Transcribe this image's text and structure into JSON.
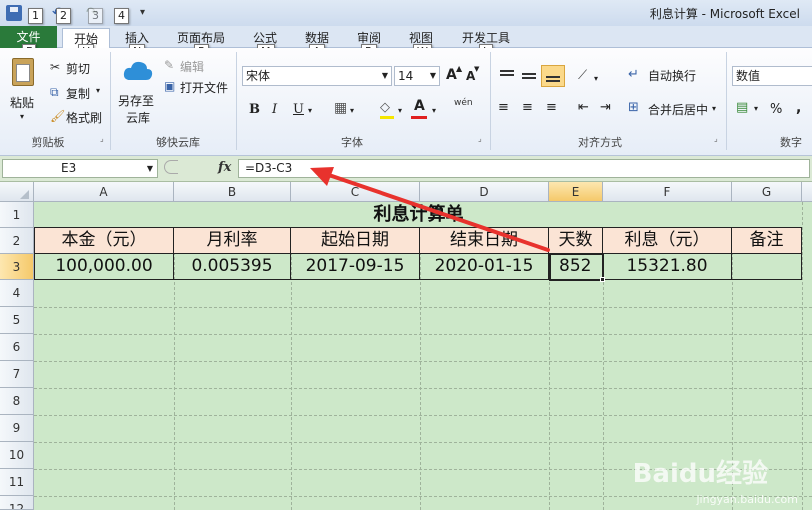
{
  "window": {
    "title": "利息计算 - Microsoft Excel"
  },
  "quick_access": {
    "keytips": [
      "1",
      "2",
      "3",
      "4"
    ]
  },
  "tabs": {
    "file": "文件",
    "items": [
      {
        "label": "开始",
        "key": "H"
      },
      {
        "label": "插入",
        "key": "N"
      },
      {
        "label": "页面布局",
        "key": "P"
      },
      {
        "label": "公式",
        "key": "M"
      },
      {
        "label": "数据",
        "key": "A"
      },
      {
        "label": "审阅",
        "key": "R"
      },
      {
        "label": "视图",
        "key": "W"
      },
      {
        "label": "开发工具",
        "key": "L"
      }
    ],
    "file_key": "F"
  },
  "ribbon": {
    "clipboard": {
      "paste": "粘贴",
      "cut": "剪切",
      "copy": "复制",
      "format_painter": "格式刷",
      "label": "剪贴板"
    },
    "cloud": {
      "save_to": "另存至",
      "cloud": "云库",
      "edit": "编辑",
      "open_file": "打开文件",
      "label": "够快云库"
    },
    "font": {
      "name": "宋体",
      "size": "14",
      "bold": "B",
      "italic": "I",
      "underline": "U",
      "grow": "A",
      "shrink": "A",
      "font_color": "A",
      "phonetic": "wén",
      "label": "字体"
    },
    "alignment": {
      "wrap": "自动换行",
      "merge": "合并后居中",
      "label": "对齐方式"
    },
    "number": {
      "format": "数值",
      "percent": "%",
      "comma": ",",
      "label": "数字"
    }
  },
  "formula_bar": {
    "name_box": "E3",
    "fx": "fx",
    "formula": "=D3-C3"
  },
  "sheet": {
    "columns": [
      "A",
      "B",
      "C",
      "D",
      "E",
      "F",
      "G"
    ],
    "rows": [
      "1",
      "2",
      "3",
      "4",
      "5",
      "6",
      "7",
      "8",
      "9",
      "10",
      "11",
      "12"
    ],
    "title": "利息计算单",
    "headers": [
      "本金（元）",
      "月利率",
      "起始日期",
      "结束日期",
      "天数",
      "利息（元）",
      "备注"
    ],
    "data": [
      "100,000.00",
      "0.005395",
      "2017-09-15",
      "2020-01-15",
      "852",
      "15321.80",
      ""
    ],
    "header_fill": "#fbe4d5",
    "sheet_fill": "#cde8c9"
  },
  "annotation": {
    "arrow_color": "#e8322d"
  },
  "watermark": {
    "logo": "Baidu经验",
    "url": "jingyan.baidu.com"
  }
}
